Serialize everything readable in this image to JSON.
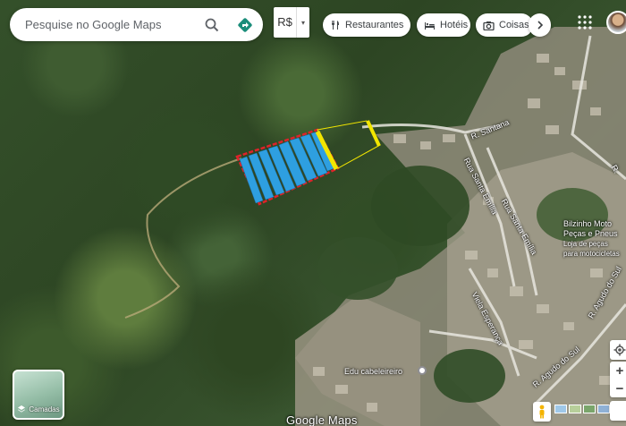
{
  "search": {
    "placeholder": "Pesquise no Google Maps",
    "search_icon": "search-icon",
    "directions_icon": "directions-icon"
  },
  "currency": {
    "symbol": "R$",
    "caret": "▾"
  },
  "chips": [
    {
      "label": "Restaurantes",
      "icon": "fork-knife-icon"
    },
    {
      "label": "Hotéis",
      "icon": "bed-icon"
    },
    {
      "label": "Coisas",
      "icon": "camera-icon"
    }
  ],
  "roads": {
    "santana": "R. Santana",
    "santa_emilia_1": "Rua Santa Emília",
    "santa_emilia_2": "Rua Santa Emília",
    "esperanca": "Viela Esperança",
    "agudo_sul_1": "R. Agudo do Sul",
    "agudo_sul_2": "R. Agudo do Sul",
    "r_partial": "R."
  },
  "pois": {
    "motos_name_1": "Bilzinho Moto",
    "motos_name_2": "Peças e Pneus",
    "motos_sub_1": "Loja de peças",
    "motos_sub_2": "para motocicletas",
    "barber": "Edu cabeleireiro"
  },
  "layers": {
    "label": "Camadas",
    "icon": "layers-icon"
  },
  "branding": {
    "logo_text": "Google Maps"
  },
  "controls": {
    "zoom_in": "+",
    "zoom_out": "−",
    "locate_icon": "my-location-icon",
    "pegman_icon": "pegman-icon"
  },
  "colors": {
    "panel_fill": "#2e9fe0",
    "boundary": "#e0222a",
    "marker": "#f2e600",
    "link_line": "#f2e600"
  }
}
